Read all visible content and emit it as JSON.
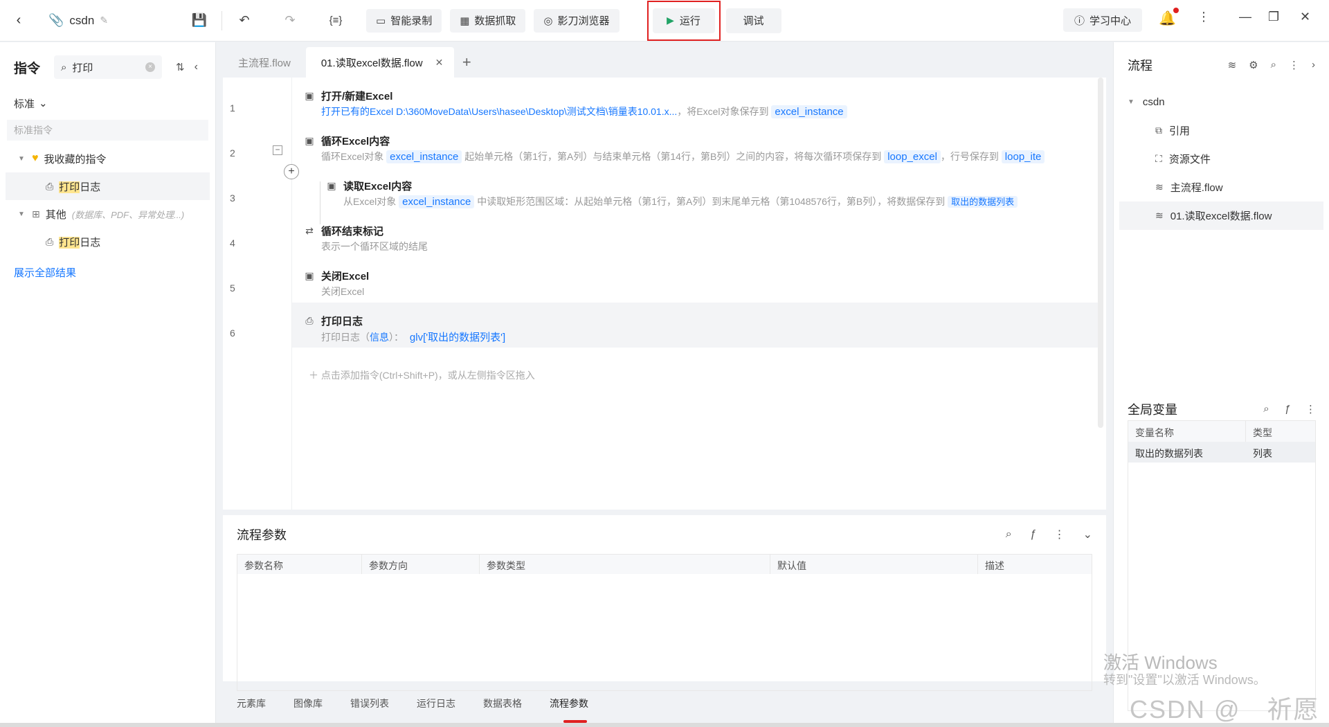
{
  "topbar": {
    "project_name": "csdn",
    "buttons": {
      "smart_record": "智能录制",
      "data_capture": "数据抓取",
      "browser": "影刀浏览器",
      "run": "运行",
      "debug": "调试",
      "learn": "学习中心"
    }
  },
  "left": {
    "title": "指令",
    "search_value": "打印",
    "standard": "标准",
    "standard_sub": "标准指令",
    "favorites": "我收藏的指令",
    "fav_item_hl": "打印",
    "fav_item_rest": "日志",
    "others": "其他",
    "others_hint": "(数据库、PDF、异常处理...)",
    "other_item_hl": "打印",
    "other_item_rest": "日志",
    "show_all": "展示全部结果"
  },
  "tabs": [
    {
      "label": "主流程.flow"
    },
    {
      "label": "01.读取excel数据.flow"
    }
  ],
  "steps": [
    {
      "line": "1",
      "title": "打开/新建Excel",
      "desc_link": "打开已有的Excel D:\\360MoveData\\Users\\hasee\\Desktop\\测试文档\\销量表10.01.x...",
      "desc_mid": "，将Excel对象保存到",
      "var": "excel_instance"
    },
    {
      "line": "2",
      "title": "循环Excel内容",
      "desc_a": "循环Excel对象",
      "var1": "excel_instance",
      "desc_b": "起始单元格（第1行，第A列）与结束单元格（第14行，第B列）之间的内容，将每次循环项保存到",
      "var2": "loop_excel",
      "desc_c": "，行号保存到",
      "var3": "loop_ite"
    },
    {
      "line": "3",
      "title": "读取Excel内容",
      "desc_a": "从Excel对象",
      "var1": "excel_instance",
      "desc_b": "中读取矩形范围区域：从起始单元格（第1行，第A列）到末尾单元格（第1048576行，第B列），将数据保存到",
      "var2": "取出的数据列表"
    },
    {
      "line": "4",
      "title": "循环结束标记",
      "desc": "表示一个循环区域的结尾"
    },
    {
      "line": "5",
      "title": "关闭Excel",
      "desc": "关闭Excel"
    },
    {
      "line": "6",
      "title": "打印日志",
      "desc_a": "打印日志（",
      "level": "信息",
      "desc_b": "）：",
      "expr": "glv['取出的数据列表']"
    }
  ],
  "add_hint": "点击添加指令(Ctrl+Shift+P)，或从左侧指令区拖入",
  "params": {
    "title": "流程参数",
    "columns": [
      "参数名称",
      "参数方向",
      "参数类型",
      "默认值",
      "描述"
    ]
  },
  "bottom_tabs": [
    "元素库",
    "图像库",
    "错误列表",
    "运行日志",
    "数据表格",
    "流程参数"
  ],
  "right": {
    "title": "流程",
    "root": "csdn",
    "items": [
      "引用",
      "资源文件",
      "主流程.flow",
      "01.读取excel数据.flow"
    ],
    "gv_title": "全局变量",
    "gv_columns": [
      "变量名称",
      "类型"
    ],
    "gv_rows": [
      {
        "name": "取出的数据列表",
        "type": "列表"
      }
    ]
  },
  "watermark": {
    "line1": "激活 Windows",
    "line2": "转到\"设置\"以激活 Windows。",
    "csdn": "CSDN @　祈愿"
  }
}
